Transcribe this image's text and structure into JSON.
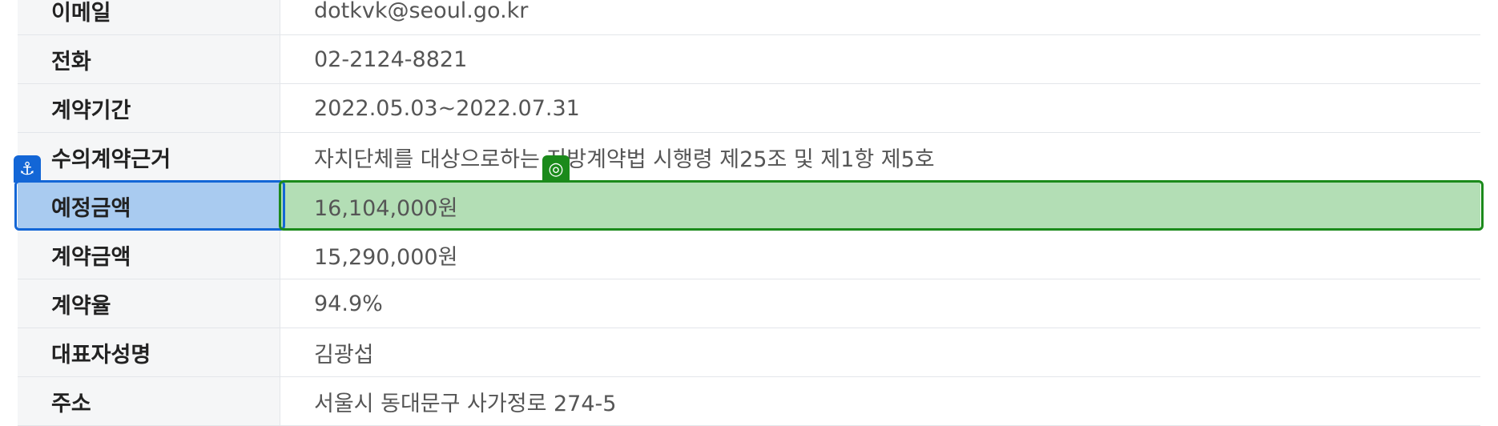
{
  "rows": [
    {
      "label": "이메일",
      "value": "dotkvk@seoul.go.kr"
    },
    {
      "label": "전화",
      "value": "02-2124-8821"
    },
    {
      "label": "계약기간",
      "value": "2022.05.03~2022.07.31"
    },
    {
      "label": "수의계약근거",
      "value": "자치단체를 대상으로하는 지방계약법 시행령 제25조 및 제1항 제5호"
    },
    {
      "label": "예정금액",
      "value": "16,104,000원"
    },
    {
      "label": "계약금액",
      "value": "15,290,000원"
    },
    {
      "label": "계약율",
      "value": "94.9%"
    },
    {
      "label": "대표자성명",
      "value": "김광섭"
    },
    {
      "label": "주소",
      "value": "서울시 동대문구 사가정로 274-5"
    }
  ],
  "markers": {
    "anchor_icon": "anchor-icon",
    "target_icon": "target-icon",
    "anchor_color": "#1366d6",
    "target_color": "#1b8a1b"
  }
}
